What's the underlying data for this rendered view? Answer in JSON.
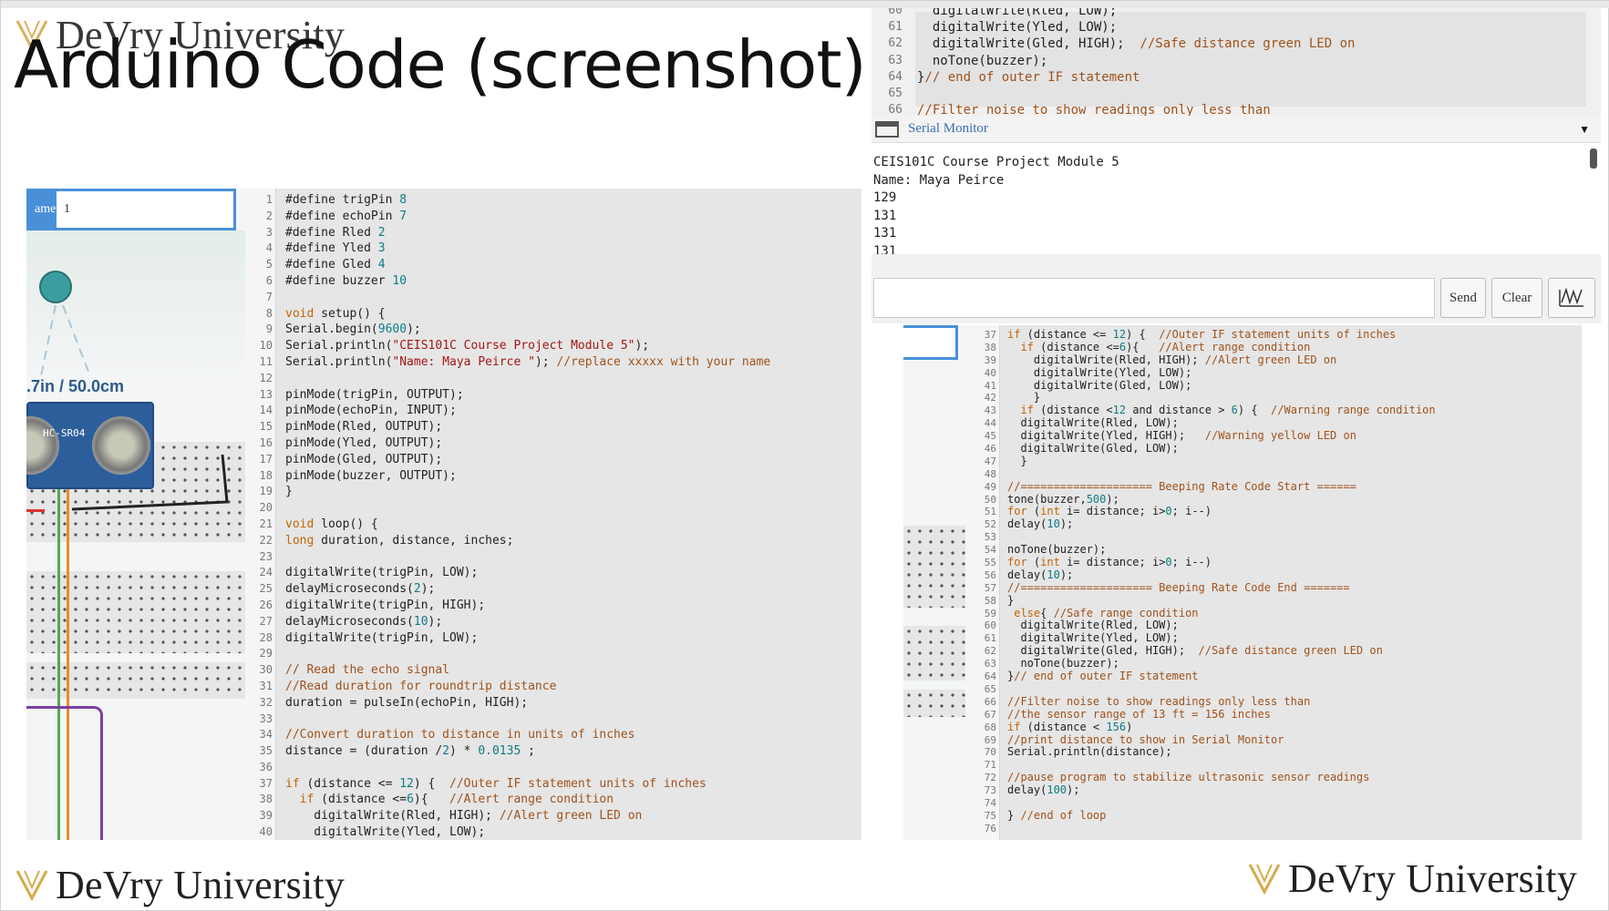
{
  "slide": {
    "title": "Arduino Code (screenshot)",
    "logo_text": "DeVry University"
  },
  "simulator": {
    "name_label": "ame",
    "name_value": "1",
    "distance_readout": ".7in / 50.0cm",
    "sensor_label": "HC-SR04"
  },
  "serial_monitor": {
    "title": "Serial Monitor",
    "output": [
      "CEIS101C Course Project Module 5",
      "Name: Maya Peirce",
      "129",
      "131",
      "131",
      "131"
    ],
    "send_label": "Send",
    "clear_label": "Clear"
  },
  "code_left": [
    {
      "n": "1",
      "t": "#define trigPin 8"
    },
    {
      "n": "2",
      "t": "#define echoPin 7"
    },
    {
      "n": "3",
      "t": "#define Rled 2"
    },
    {
      "n": "4",
      "t": "#define Yled 3"
    },
    {
      "n": "5",
      "t": "#define Gled 4"
    },
    {
      "n": "6",
      "t": "#define buzzer 10"
    },
    {
      "n": "7",
      "t": ""
    },
    {
      "n": "8",
      "t": "void setup() {"
    },
    {
      "n": "9",
      "t": "Serial.begin(9600);"
    },
    {
      "n": "10",
      "t": "Serial.println(\"CEIS101C Course Project Module 5\");"
    },
    {
      "n": "11",
      "t": "Serial.println(\"Name: Maya Peirce \"); //replace xxxxx with your name"
    },
    {
      "n": "12",
      "t": ""
    },
    {
      "n": "13",
      "t": "pinMode(trigPin, OUTPUT);"
    },
    {
      "n": "14",
      "t": "pinMode(echoPin, INPUT);"
    },
    {
      "n": "15",
      "t": "pinMode(Rled, OUTPUT);"
    },
    {
      "n": "16",
      "t": "pinMode(Yled, OUTPUT);"
    },
    {
      "n": "17",
      "t": "pinMode(Gled, OUTPUT);"
    },
    {
      "n": "18",
      "t": "pinMode(buzzer, OUTPUT);"
    },
    {
      "n": "19",
      "t": "}"
    },
    {
      "n": "20",
      "t": ""
    },
    {
      "n": "21",
      "t": "void loop() {"
    },
    {
      "n": "22",
      "t": "long duration, distance, inches;"
    },
    {
      "n": "23",
      "t": ""
    },
    {
      "n": "24",
      "t": "digitalWrite(trigPin, LOW);"
    },
    {
      "n": "25",
      "t": "delayMicroseconds(2);"
    },
    {
      "n": "26",
      "t": "digitalWrite(trigPin, HIGH);"
    },
    {
      "n": "27",
      "t": "delayMicroseconds(10);"
    },
    {
      "n": "28",
      "t": "digitalWrite(trigPin, LOW);"
    },
    {
      "n": "29",
      "t": ""
    },
    {
      "n": "30",
      "t": "// Read the echo signal"
    },
    {
      "n": "31",
      "t": "//Read duration for roundtrip distance"
    },
    {
      "n": "32",
      "t": "duration = pulseIn(echoPin, HIGH);"
    },
    {
      "n": "33",
      "t": ""
    },
    {
      "n": "34",
      "t": "//Convert duration to distance in units of inches"
    },
    {
      "n": "35",
      "t": "distance = (duration /2) * 0.0135 ;"
    },
    {
      "n": "36",
      "t": ""
    },
    {
      "n": "37",
      "t": "if (distance <= 12) {  //Outer IF statement units of inches"
    },
    {
      "n": "38",
      "t": "  if (distance <=6){   //Alert range condition"
    },
    {
      "n": "39",
      "t": "    digitalWrite(Rled, HIGH); //Alert green LED on"
    },
    {
      "n": "40",
      "t": "    digitalWrite(Yled, LOW);"
    }
  ],
  "code_top_right": [
    {
      "n": "60",
      "t": "  digitalWrite(Rled, LOW);"
    },
    {
      "n": "61",
      "t": "  digitalWrite(Yled, LOW);"
    },
    {
      "n": "62",
      "t": "  digitalWrite(Gled, HIGH);  //Safe distance green LED on"
    },
    {
      "n": "63",
      "t": "  noTone(buzzer);"
    },
    {
      "n": "64",
      "t": "}// end of outer IF statement"
    },
    {
      "n": "65",
      "t": ""
    },
    {
      "n": "66",
      "t": "//Filter noise to show readings only less than"
    }
  ],
  "code_bottom_right": [
    {
      "n": "37",
      "t": "if (distance <= 12) {  //Outer IF statement units of inches"
    },
    {
      "n": "38",
      "t": "  if (distance <=6){   //Alert range condition"
    },
    {
      "n": "39",
      "t": "    digitalWrite(Rled, HIGH); //Alert green LED on"
    },
    {
      "n": "40",
      "t": "    digitalWrite(Yled, LOW);"
    },
    {
      "n": "41",
      "t": "    digitalWrite(Gled, LOW);"
    },
    {
      "n": "42",
      "t": "    }"
    },
    {
      "n": "43",
      "t": "  if (distance <12 and distance > 6) {  //Warning range condition"
    },
    {
      "n": "44",
      "t": "  digitalWrite(Rled, LOW);"
    },
    {
      "n": "45",
      "t": "  digitalWrite(Yled, HIGH);   //Warning yellow LED on"
    },
    {
      "n": "46",
      "t": "  digitalWrite(Gled, LOW);"
    },
    {
      "n": "47",
      "t": "  }"
    },
    {
      "n": "48",
      "t": ""
    },
    {
      "n": "49",
      "t": "//==================== Beeping Rate Code Start ======"
    },
    {
      "n": "50",
      "t": "tone(buzzer,500);"
    },
    {
      "n": "51",
      "t": "for (int i= distance; i>0; i--)"
    },
    {
      "n": "52",
      "t": "delay(10);"
    },
    {
      "n": "53",
      "t": ""
    },
    {
      "n": "54",
      "t": "noTone(buzzer);"
    },
    {
      "n": "55",
      "t": "for (int i= distance; i>0; i--)"
    },
    {
      "n": "56",
      "t": "delay(10);"
    },
    {
      "n": "57",
      "t": "//==================== Beeping Rate Code End ======="
    },
    {
      "n": "58",
      "t": "}"
    },
    {
      "n": "59",
      "t": " else{ //Safe range condition"
    },
    {
      "n": "60",
      "t": "  digitalWrite(Rled, LOW);"
    },
    {
      "n": "61",
      "t": "  digitalWrite(Yled, LOW);"
    },
    {
      "n": "62",
      "t": "  digitalWrite(Gled, HIGH);  //Safe distance green LED on"
    },
    {
      "n": "63",
      "t": "  noTone(buzzer);"
    },
    {
      "n": "64",
      "t": "}// end of outer IF statement"
    },
    {
      "n": "65",
      "t": ""
    },
    {
      "n": "66",
      "t": "//Filter noise to show readings only less than"
    },
    {
      "n": "67",
      "t": "//the sensor range of 13 ft = 156 inches"
    },
    {
      "n": "68",
      "t": "if (distance < 156)"
    },
    {
      "n": "69",
      "t": "//print distance to show in Serial Monitor"
    },
    {
      "n": "70",
      "t": "Serial.println(distance);"
    },
    {
      "n": "71",
      "t": ""
    },
    {
      "n": "72",
      "t": "//pause program to stabilize ultrasonic sensor readings"
    },
    {
      "n": "73",
      "t": "delay(100);"
    },
    {
      "n": "74",
      "t": ""
    },
    {
      "n": "75",
      "t": "} //end of loop"
    },
    {
      "n": "76",
      "t": ""
    }
  ],
  "colors": {
    "keyword": "#c26400",
    "comment": "#a0521a",
    "number": "#0d7c85",
    "string": "#a31515",
    "accent_blue": "#4a90d9"
  }
}
